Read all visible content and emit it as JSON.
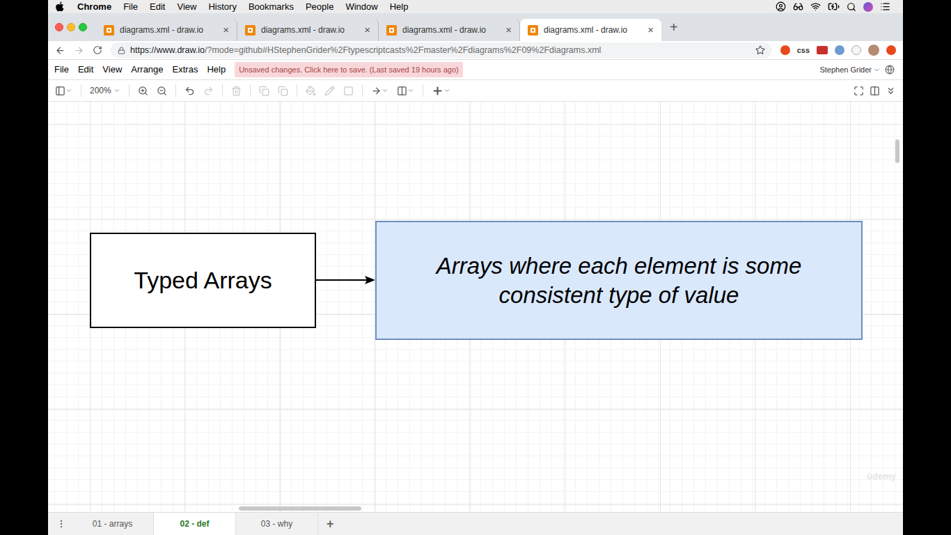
{
  "menubar": {
    "app": "Chrome",
    "items": [
      "File",
      "Edit",
      "View",
      "History",
      "Bookmarks",
      "People",
      "Window",
      "Help"
    ]
  },
  "browser_tabs": [
    {
      "title": "diagrams.xml - draw.io",
      "selected": false,
      "close": "×"
    },
    {
      "title": "diagrams.xml - draw.io",
      "selected": false,
      "close": "×"
    },
    {
      "title": "diagrams.xml - draw.io",
      "selected": false,
      "close": "×"
    },
    {
      "title": "diagrams.xml - draw.io",
      "selected": true,
      "close": "×"
    }
  ],
  "new_tab": "+",
  "address": {
    "url_host": "https://www.draw.io",
    "url_rest": "/?mode=github#HStephenGrider%2Ftypescriptcasts%2Fmaster%2Fdiagrams%2F09%2Fdiagrams.xml"
  },
  "extensions": [
    "css"
  ],
  "app_menu": [
    "File",
    "Edit",
    "View",
    "Arrange",
    "Extras",
    "Help"
  ],
  "notice": "Unsaved changes. Click here to save. (Last saved 19 hours ago)",
  "user": "Stephen Grider",
  "zoom": "200%",
  "diagram": {
    "nodes": [
      {
        "label": "Typed Arrays",
        "kind": "term"
      },
      {
        "label": "Arrays where each element is some consistent type of value",
        "kind": "definition"
      }
    ]
  },
  "pages": [
    {
      "label": "01 - arrays",
      "selected": false
    },
    {
      "label": "02 - def",
      "selected": true
    },
    {
      "label": "03 - why",
      "selected": false
    }
  ],
  "add_page": "+",
  "watermark": "ūdemy"
}
